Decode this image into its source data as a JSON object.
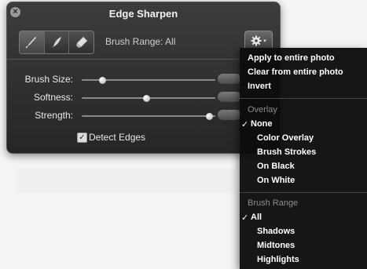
{
  "panel": {
    "title": "Edge Sharpen",
    "brush_range_label": "Brush Range: All",
    "sliders": [
      {
        "label": "Brush Size:",
        "value": 0.15
      },
      {
        "label": "Softness:",
        "value": 0.48
      },
      {
        "label": "Strength:",
        "value": 0.95
      }
    ],
    "detect_edges_label": "Detect Edges",
    "detect_edges_checked": true
  },
  "menu": {
    "actions": [
      "Apply to entire photo",
      "Clear from entire photo",
      "Invert"
    ],
    "overlay_header": "Overlay",
    "overlay_items": [
      {
        "label": "None",
        "checked": true
      },
      {
        "label": "Color Overlay",
        "checked": false
      },
      {
        "label": "Brush Strokes",
        "checked": false
      },
      {
        "label": "On Black",
        "checked": false
      },
      {
        "label": "On White",
        "checked": false
      }
    ],
    "brush_range_header": "Brush Range",
    "brush_range_items": [
      {
        "label": "All",
        "checked": true
      },
      {
        "label": "Shadows",
        "checked": false
      },
      {
        "label": "Midtones",
        "checked": false
      },
      {
        "label": "Highlights",
        "checked": false
      }
    ],
    "check_glyph": "✓"
  },
  "colors": {
    "panel_bg": "#2e2e2e",
    "menu_bg": "#0c0c0c",
    "header_text": "#8d8d8d"
  }
}
